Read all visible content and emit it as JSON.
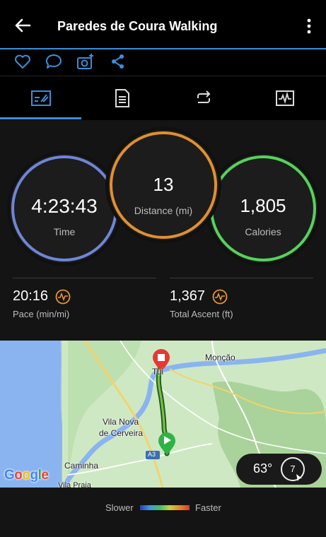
{
  "header": {
    "title": "Paredes de Coura Walking"
  },
  "icons": {
    "back": "back-arrow-icon",
    "more": "more-vert-icon",
    "like": "heart-icon",
    "comment": "comment-icon",
    "photo": "add-photo-icon",
    "share": "share-icon"
  },
  "tabs": [
    "summary-tab",
    "details-tab",
    "laps-tab",
    "charts-tab"
  ],
  "stats": {
    "time": {
      "value": "4:23:43",
      "label": "Time",
      "color": "#6f86d6"
    },
    "distance": {
      "value": "13",
      "label": "Distance (mi)",
      "color": "#e0902f"
    },
    "calories": {
      "value": "1,805",
      "label": "Calories",
      "color": "#55d35a"
    }
  },
  "metrics": {
    "pace": {
      "value": "20:16",
      "label": "Pace (min/mi)"
    },
    "ascent": {
      "value": "1,367",
      "label": "Total Ascent (ft)"
    }
  },
  "map": {
    "labels": {
      "tui": "Tui",
      "moncao": "Monção",
      "vila_nova": "Vila Nova",
      "cerveira": "de Cerveira",
      "caminha": "Caminha",
      "vila_praia": "Vila Praia",
      "a3": "A3"
    },
    "google": "Google",
    "weather": {
      "temp": "63°",
      "wind": "7"
    }
  },
  "legend": {
    "slower": "Slower",
    "faster": "Faster"
  },
  "colors": {
    "accent": "#3b8fd9",
    "icon_orange": "#e8952e",
    "track": "#4caf50",
    "start_pin": "#2fb344",
    "end_pin": "#e53935"
  }
}
